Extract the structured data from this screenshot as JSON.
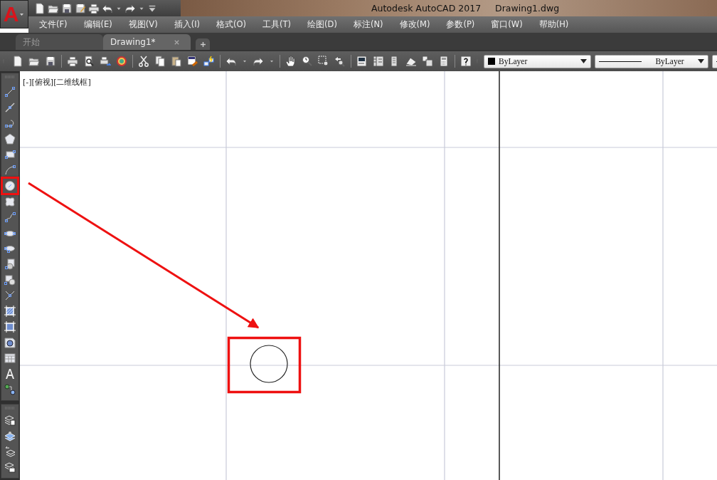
{
  "app_button": {
    "label": "A"
  },
  "title_bar": {
    "app_title": "Autodesk AutoCAD 2017",
    "file_name": "Drawing1.dwg"
  },
  "menu_bar": {
    "items": [
      "文件(F)",
      "编辑(E)",
      "视图(V)",
      "插入(I)",
      "格式(O)",
      "工具(T)",
      "绘图(D)",
      "标注(N)",
      "修改(M)",
      "参数(P)",
      "窗口(W)",
      "帮助(H)"
    ]
  },
  "file_tabs": [
    {
      "label": "开始",
      "selected": false
    },
    {
      "label": "Drawing1*",
      "selected": true
    }
  ],
  "toolbar": {
    "color_dropdown": {
      "value": "ByLayer"
    },
    "linetype_dropdown": {
      "value": "ByLayer"
    }
  },
  "draw_tools": [
    {
      "highlighted": false
    },
    {
      "highlighted": false
    },
    {
      "highlighted": false
    },
    {
      "highlighted": false
    },
    {
      "highlighted": false
    },
    {
      "highlighted": false
    },
    {
      "highlighted": true
    },
    {
      "highlighted": false
    },
    {
      "highlighted": false
    },
    {
      "highlighted": false
    },
    {
      "highlighted": false
    },
    {
      "highlighted": false
    },
    {
      "highlighted": false
    },
    {
      "highlighted": false
    },
    {
      "highlighted": false
    },
    {
      "highlighted": false
    },
    {
      "highlighted": false
    },
    {
      "highlighted": false
    },
    {
      "highlighted": false
    },
    {
      "highlighted": false
    }
  ],
  "viewport": {
    "label": "[-][俯视][二维线框]"
  }
}
